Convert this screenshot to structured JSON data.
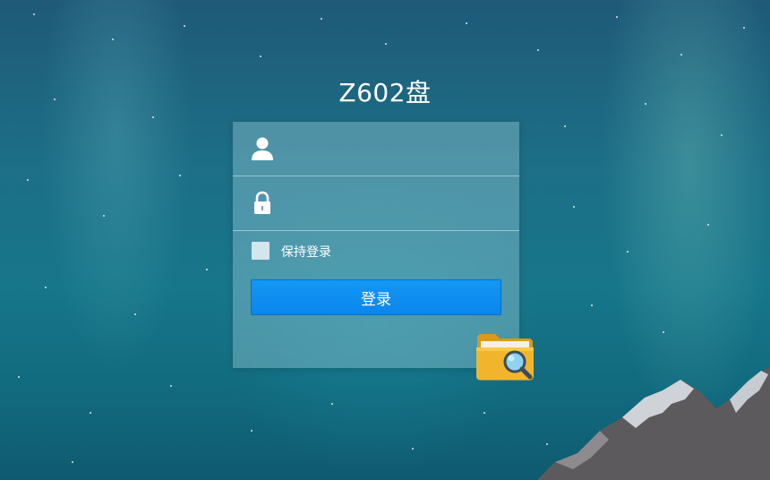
{
  "app": {
    "title": "Z602盘"
  },
  "login_form": {
    "username": {
      "value": "",
      "placeholder": "",
      "icon": "user-icon"
    },
    "password": {
      "value": "",
      "placeholder": "",
      "icon": "lock-icon"
    },
    "remember_me": {
      "label": "保持登录",
      "checked": false
    },
    "submit_label": "登录"
  },
  "decorations": {
    "app_icon": "folder-search-icon"
  },
  "colors": {
    "button_primary": "#0a86ec",
    "panel_overlay": "rgba(150,200,215,0.42)",
    "text": "#ffffff"
  }
}
